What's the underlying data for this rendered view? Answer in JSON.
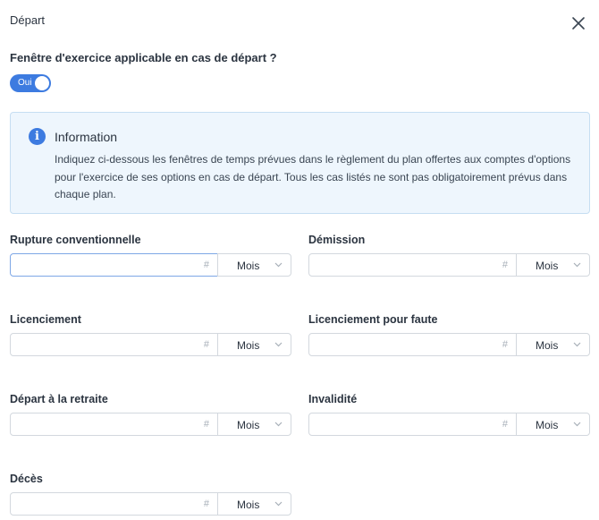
{
  "modal": {
    "title": "Départ",
    "question": "Fenêtre d'exercice applicable en cas de départ ?",
    "toggle_label": "Oui"
  },
  "info": {
    "title": "Information",
    "text": "Indiquez ci-dessous les fenêtres de temps prévues dans le règlement du plan offertes aux comptes d'options pour l'exercice de ses options en cas de départ. Tous les cas listés ne sont pas obligatoirement prévus dans chaque plan."
  },
  "fields": [
    {
      "label": "Rupture conventionnelle",
      "value": "",
      "placeholder_symbol": "#",
      "unit": "Mois"
    },
    {
      "label": "Démission",
      "value": "",
      "placeholder_symbol": "#",
      "unit": "Mois"
    },
    {
      "label": "Licenciement",
      "value": "",
      "placeholder_symbol": "#",
      "unit": "Mois"
    },
    {
      "label": "Licenciement pour faute",
      "value": "",
      "placeholder_symbol": "#",
      "unit": "Mois"
    },
    {
      "label": "Départ à la retraite",
      "value": "",
      "placeholder_symbol": "#",
      "unit": "Mois"
    },
    {
      "label": "Invalidité",
      "value": "",
      "placeholder_symbol": "#",
      "unit": "Mois"
    },
    {
      "label": "Décès",
      "value": "",
      "placeholder_symbol": "#",
      "unit": "Mois"
    }
  ],
  "colors": {
    "accent": "#3d7be0",
    "info_bg": "#eef6fd",
    "info_border": "#c6def2",
    "input_border": "#d3d8de",
    "focus_border": "#7ea7e6"
  },
  "icons": {
    "close": "close-icon",
    "info": "info-icon",
    "chevron": "chevron-down-icon"
  }
}
